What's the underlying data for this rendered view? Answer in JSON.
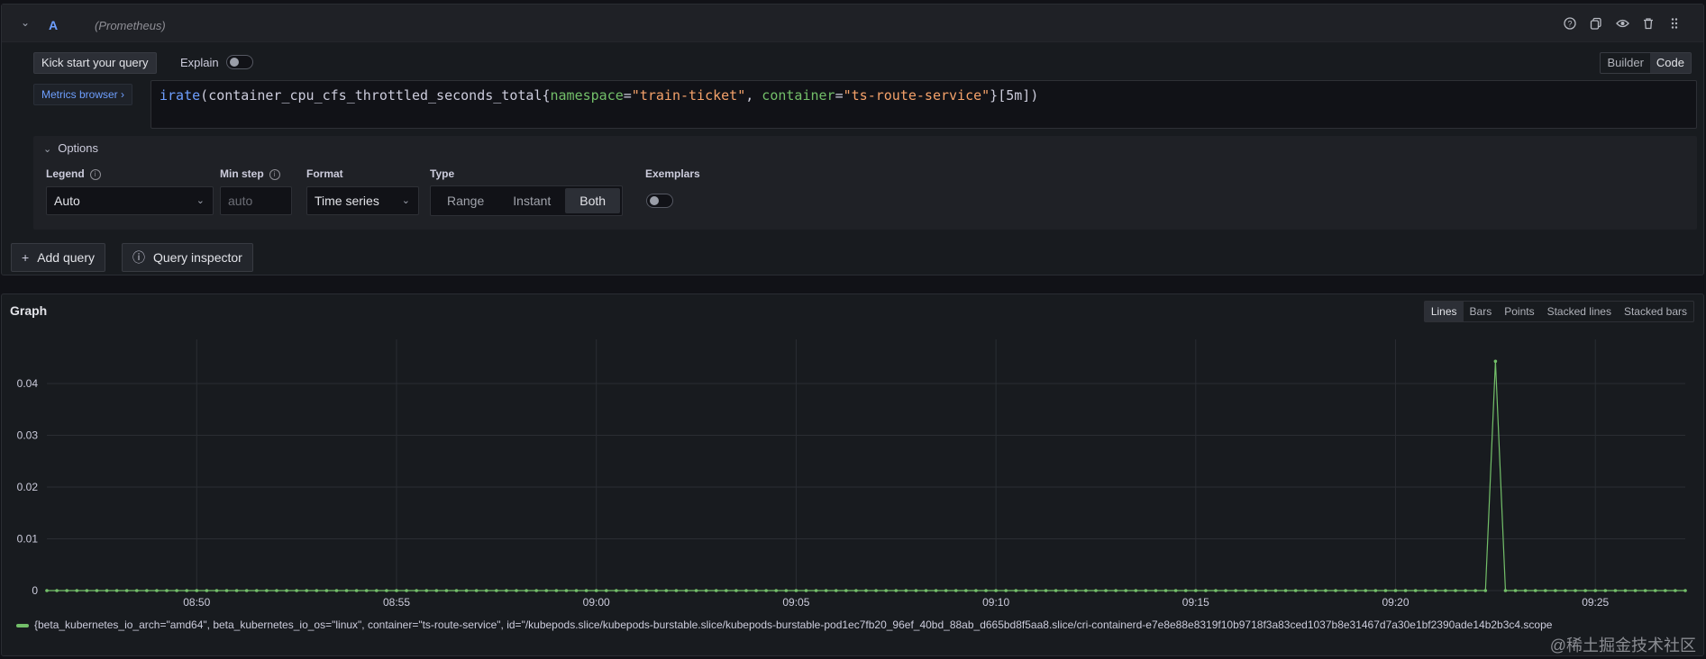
{
  "query": {
    "letter": "A",
    "datasource": "(Prometheus)",
    "icons": [
      "help-icon",
      "duplicate-icon",
      "eye-icon",
      "trash-icon",
      "drag-handle-icon"
    ],
    "kick_start_label": "Kick start your query",
    "explain_label": "Explain",
    "explain_on": false,
    "mode_builder": "Builder",
    "mode_code": "Code",
    "mode_active": "Code",
    "metrics_browser_label": "Metrics browser ›",
    "expr": {
      "fn": "irate",
      "open": "(",
      "metric": "container_cpu_cfs_throttled_seconds_total",
      "brace_open": "{",
      "label1": "namespace",
      "eq1": "=",
      "val1": "\"train-ticket\"",
      "comma": ", ",
      "label2": "container",
      "eq2": "=",
      "val2": "\"ts-route-service\"",
      "brace_close": "}",
      "range": "[5m]",
      "close": ")"
    }
  },
  "options": {
    "title": "Options",
    "legend_label": "Legend",
    "legend_value": "Auto",
    "minstep_label": "Min step",
    "minstep_placeholder": "auto",
    "format_label": "Format",
    "format_value": "Time series",
    "type_label": "Type",
    "type_options": [
      "Range",
      "Instant",
      "Both"
    ],
    "type_active": "Both",
    "exemplars_label": "Exemplars",
    "exemplars_on": false
  },
  "actions": {
    "add_query": "Add query",
    "query_inspector": "Query inspector"
  },
  "graph": {
    "title": "Graph",
    "modes": [
      "Lines",
      "Bars",
      "Points",
      "Stacked lines",
      "Stacked bars"
    ],
    "mode_active": "Lines",
    "legend_text": "{beta_kubernetes_io_arch=\"amd64\", beta_kubernetes_io_os=\"linux\", container=\"ts-route-service\", id=\"/kubepods.slice/kubepods-burstable.slice/kubepods-burstable-pod1ec7fb20_96ef_40bd_88ab_d665bd8f5aa8.slice/cri-containerd-e7e8e88e8319f10b9718f3a83ced1037b8e31467d7a30e1bf2390ade14b2b3c4.scope",
    "line_color": "#73bf69"
  },
  "chart_data": {
    "type": "line",
    "y_ticks": [
      "0",
      "0.01",
      "0.02",
      "0.03",
      "0.04"
    ],
    "ylim": [
      0,
      0.04
    ],
    "x_ticks": [
      "08:50",
      "08:55",
      "09:00",
      "09:05",
      "09:10",
      "09:15",
      "09:20",
      "09:25"
    ],
    "x_range": [
      "08:46:15",
      "09:27:15"
    ],
    "step_seconds": 15,
    "series": [
      {
        "baseline": 0,
        "spike": {
          "time": "09:22:30",
          "value": 0.0443
        }
      }
    ],
    "grid": true,
    "legend_position": "bottom-left"
  },
  "watermark": "@稀土掘金技术社区"
}
